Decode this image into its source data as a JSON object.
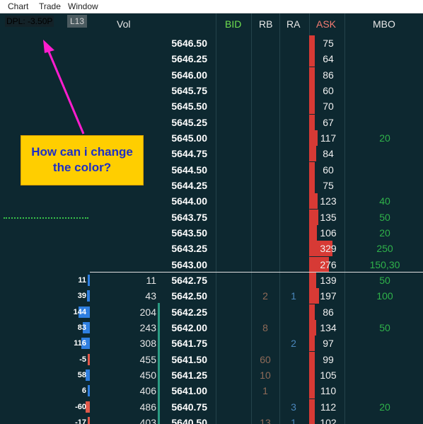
{
  "menu": {
    "items": [
      "Chart",
      "Trade",
      "Window"
    ]
  },
  "toolbar": {
    "dpl": "DPL: -3.50P",
    "l13": "L13"
  },
  "headers": {
    "vol": "Vol",
    "bid": "BID",
    "rb": "RB",
    "ra": "RA",
    "ask": "ASK",
    "mbo": "MBO"
  },
  "colors": {
    "bid_header": "#6fe04f",
    "ask_header": "#f47b72",
    "background": "#0d2830",
    "ask_bar": "#d73a35",
    "mbo_text": "#2fb24a",
    "rb_text": "#8e6a58",
    "ra_text": "#4a86bb",
    "callout_bg": "#ffce00",
    "callout_text": "#1d2fc6",
    "arrow": "#ff1dce"
  },
  "callout": {
    "line1": "How can i change",
    "line2": "the color?"
  },
  "rows": [
    {
      "price": "5646.50",
      "ask": "75",
      "ask_level": 8
    },
    {
      "price": "5646.25",
      "ask": "64",
      "ask_level": 8
    },
    {
      "price": "5646.00",
      "ask": "86",
      "ask_level": 8
    },
    {
      "price": "5645.75",
      "ask": "60",
      "ask_level": 8
    },
    {
      "price": "5645.50",
      "ask": "70",
      "ask_level": 8
    },
    {
      "price": "5645.25",
      "ask": "67",
      "ask_level": 8
    },
    {
      "price": "5645.00",
      "ask": "117",
      "ask_level": 12,
      "mbo": "20"
    },
    {
      "price": "5644.75",
      "ask": "84",
      "ask_level": 10
    },
    {
      "price": "5644.50",
      "ask": "60",
      "ask_level": 8
    },
    {
      "price": "5644.25",
      "ask": "75",
      "ask_level": 8
    },
    {
      "price": "5644.00",
      "ask": "123",
      "ask_level": 12,
      "mbo": "40"
    },
    {
      "price": "5643.75",
      "ask": "135",
      "ask_level": 13,
      "mbo": "50"
    },
    {
      "price": "5643.50",
      "ask": "106",
      "ask_level": 11,
      "mbo": "20"
    },
    {
      "price": "5643.25",
      "ask": "329",
      "ask_level": 33,
      "mbo": "250"
    },
    {
      "price": "5643.00",
      "ask": "276",
      "ask_level": 28,
      "mbo": "150,30"
    },
    {
      "price": "5642.75",
      "ask": "139",
      "ask_level": 10,
      "vol": "11",
      "delta": "11",
      "delta_level": 1,
      "mbo": "50"
    },
    {
      "price": "5642.50",
      "ask": "197",
      "ask_level": 14,
      "vol": "43",
      "delta": "39",
      "delta_level": 3,
      "rb": "2",
      "ra": "1",
      "mbo": "100"
    },
    {
      "price": "5642.25",
      "ask": "86",
      "ask_level": 8,
      "vol": "204",
      "delta": "144",
      "delta_level": 13
    },
    {
      "price": "5642.00",
      "ask": "134",
      "ask_level": 10,
      "vol": "243",
      "delta": "83",
      "delta_level": 8,
      "rb": "8",
      "mbo": "50"
    },
    {
      "price": "5641.75",
      "ask": "97",
      "ask_level": 8,
      "vol": "308",
      "delta": "116",
      "delta_level": 10,
      "ra": "2"
    },
    {
      "price": "5641.50",
      "ask": "99",
      "ask_level": 8,
      "vol": "455",
      "delta": "-5",
      "delta_level": 1,
      "rb": "60"
    },
    {
      "price": "5641.25",
      "ask": "105",
      "ask_level": 8,
      "vol": "450",
      "delta": "58",
      "delta_level": 5,
      "rb": "10"
    },
    {
      "price": "5641.00",
      "ask": "110",
      "ask_level": 8,
      "vol": "406",
      "delta": "6",
      "delta_level": 1,
      "rb": "1"
    },
    {
      "price": "5640.75",
      "ask": "112",
      "ask_level": 8,
      "vol": "486",
      "delta": "-60",
      "delta_level": 5,
      "ra": "3",
      "mbo": "20"
    },
    {
      "price": "5640.50",
      "ask": "102",
      "ask_level": 8,
      "vol": "403",
      "delta": "-17",
      "delta_level": 2,
      "rb": "13",
      "ra": "1"
    }
  ]
}
